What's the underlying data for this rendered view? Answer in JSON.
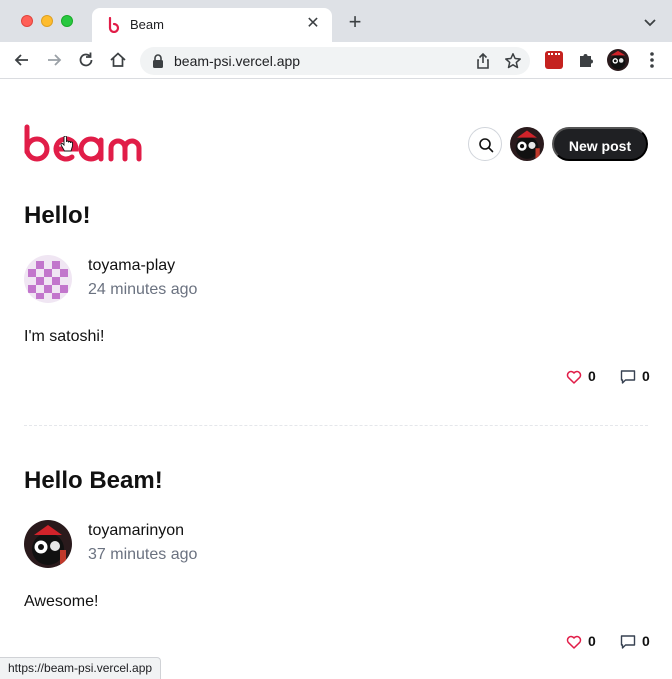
{
  "browser": {
    "tab_title": "Beam",
    "url": "beam-psi.vercel.app",
    "status_url": "https://beam-psi.vercel.app"
  },
  "colors": {
    "brand": "#e11d48",
    "button_dark": "#1f2023",
    "muted_text": "#6b7280"
  },
  "header": {
    "logo_text": "beam",
    "search_icon": "search-icon",
    "new_post_label": "New post"
  },
  "posts": [
    {
      "title": "Hello!",
      "author": "toyama-play",
      "time": "24 minutes ago",
      "body": "I'm satoshi!",
      "likes": "0",
      "comments": "0"
    },
    {
      "title": "Hello Beam!",
      "author": "toyamarinyon",
      "time": "37 minutes ago",
      "body": "Awesome!",
      "likes": "0",
      "comments": "0"
    }
  ]
}
